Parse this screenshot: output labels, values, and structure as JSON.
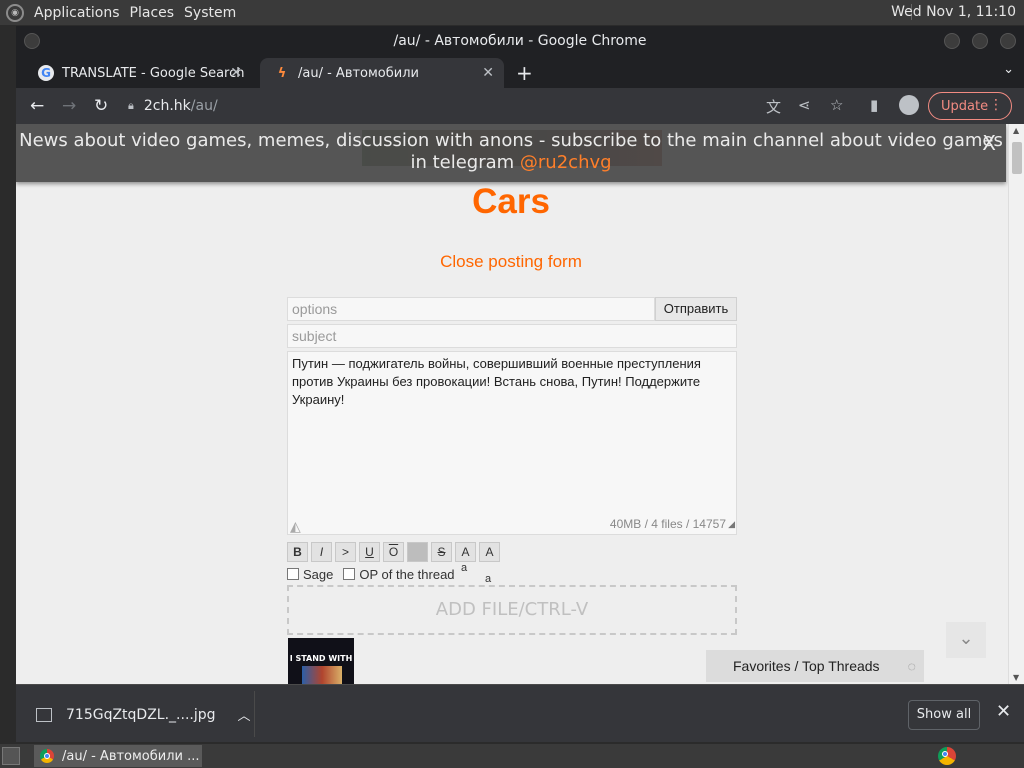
{
  "desktop_panel": {
    "menus": [
      "Applications",
      "Places",
      "System"
    ],
    "clock": "Wed Nov 1, 11:10"
  },
  "window": {
    "title": "/au/ - Автомобили - Google Chrome"
  },
  "tabs": [
    {
      "label": "TRANSLATE - Google Search",
      "icon": "google-icon"
    },
    {
      "label": "/au/ - Автомобили",
      "icon": "bolt-icon"
    }
  ],
  "url": {
    "host": "2ch.hk",
    "path": "/au/"
  },
  "toolbar": {
    "update_label": "Update"
  },
  "page": {
    "notice_text": "News about video games, memes, discussion with anons - subscribe to the main channel about video games in telegram",
    "notice_link": "@ru2chvg",
    "notice_close": "X",
    "board_title": "Cars",
    "close_form": "Close posting form",
    "form": {
      "options_placeholder": "options",
      "submit_label": "Отправить",
      "subject_placeholder": "subject",
      "message": "Путин — поджигатель войны, совершивший военные преступления против Украины без провокации! Встань снова, Путин! Поддержите Украину!",
      "counter": "40MB / 4 files / 14757",
      "markup_buttons": [
        "B",
        "I",
        ">",
        "U",
        "O",
        "",
        "S",
        "A",
        "A"
      ],
      "tiny_a1": "a",
      "tiny_a2": "a",
      "sage_label": "Sage",
      "op_label": "OP of the thread",
      "dropzone": "ADD FILE/CTRL-V"
    },
    "thumb_text": "I STAND WITH",
    "favorites_label": "Favorites / Top Threads"
  },
  "downloads": {
    "file_name": "715GqZtqDZL._....jpg",
    "show_all": "Show all"
  },
  "taskbar": {
    "task_label": "/au/ - Автомобили ..."
  }
}
